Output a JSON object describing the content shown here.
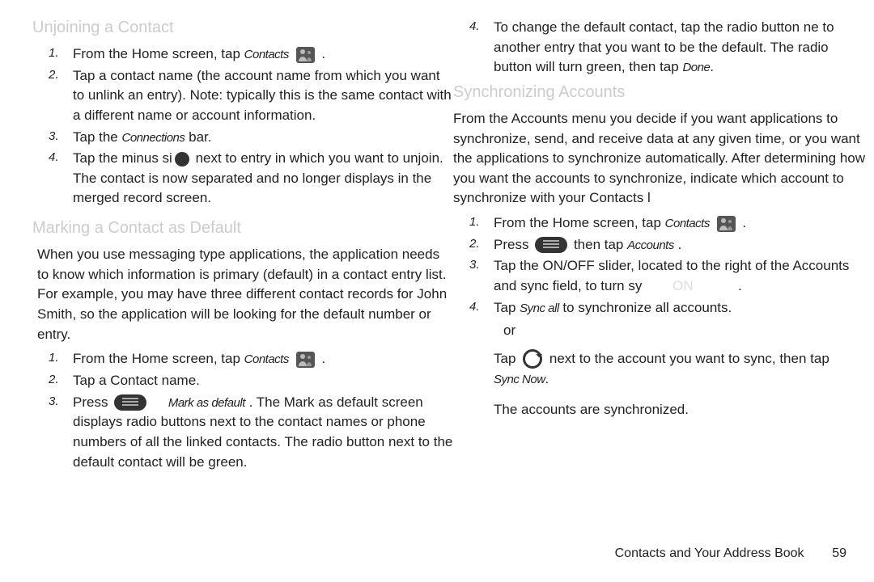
{
  "left": {
    "h1": "Unjoining a Contact",
    "s1_num": "1.",
    "s1_a": "From the Home screen, tap",
    "s1_b": "Contacts",
    "s1_c": ".",
    "s2_num": "2.",
    "s2": "Tap a contact name (the account name from which you want to unlink an entry). Note: typically this is the same contact with a different name or account information.",
    "s3_num": "3.",
    "s3_a": "Tap the",
    "s3_b": "Connections",
    "s3_c": " bar.",
    "s4_num": "4.",
    "s4_a": "Tap the minus si",
    "s4_b": " next to entry in which you want to unjoin. The contact is now separated and no longer displays in the merged record screen.",
    "h2": "Marking a Contact as Default",
    "p1": "When you use messaging type applications, the application needs to know which information is primary (default) in a contact entry list. For example, you may have three different contact records for John Smith, so the application will be looking for the  default  number or entry.",
    "m1_num": "1.",
    "m1_a": "From the Home screen, tap",
    "m1_b": "Contacts",
    "m1_c": ".",
    "m2_num": "2.",
    "m2": "Tap a Contact name.",
    "m3_num": "3.",
    "m3_a": "Press",
    "m3_b": "Mark as default",
    "m3_c": ". The Mark as default screen displays radio buttons next to the contact names or phone numbers of all the linked contacts. The radio button next to the default contact will be green."
  },
  "right": {
    "r4_num": "4.",
    "r4_a": "To change the default contact, tap the radio button ne",
    "r4_b": "to another entry that you want to be the default. The radio button will turn green, then tap",
    "r4_c": "Done",
    "r4_d": ".",
    "h3": "Synchronizing Accounts",
    "p2": "From the Accounts menu you decide if you want applications to synchronize, send, and receive data at any given time, or you want the applications to synchronize automatically. After determining how you want the accounts to synchronize, indicate which account to synchronize with your Contacts l",
    "a1_num": "1.",
    "a1_a": "From the Home screen, tap",
    "a1_b": "Contacts",
    "a1_c": ".",
    "a2_num": "2.",
    "a2_a": "Press",
    "a2_b": " then tap",
    "a2_c": "Accounts",
    "a2_d": ".",
    "a3_num": "3.",
    "a3_a": "Tap the ON/OFF slider, located to the right of the Accounts and sync field, to turn sy",
    "a3_b": "ON",
    "a3_c": ".",
    "a4_num": "4.",
    "a4_a": "Tap",
    "a4_b": "Sync all",
    "a4_c": " to synchronize all accounts.",
    "or": "or",
    "a5_a": "Tap",
    "a5_b": " next to the account you want to sync, then tap",
    "a5_c": "Sync Now",
    "a5_d": ".",
    "p3": "The accounts are synchronized."
  },
  "footer": {
    "label": "Contacts and Your Address Book",
    "page": "59"
  }
}
